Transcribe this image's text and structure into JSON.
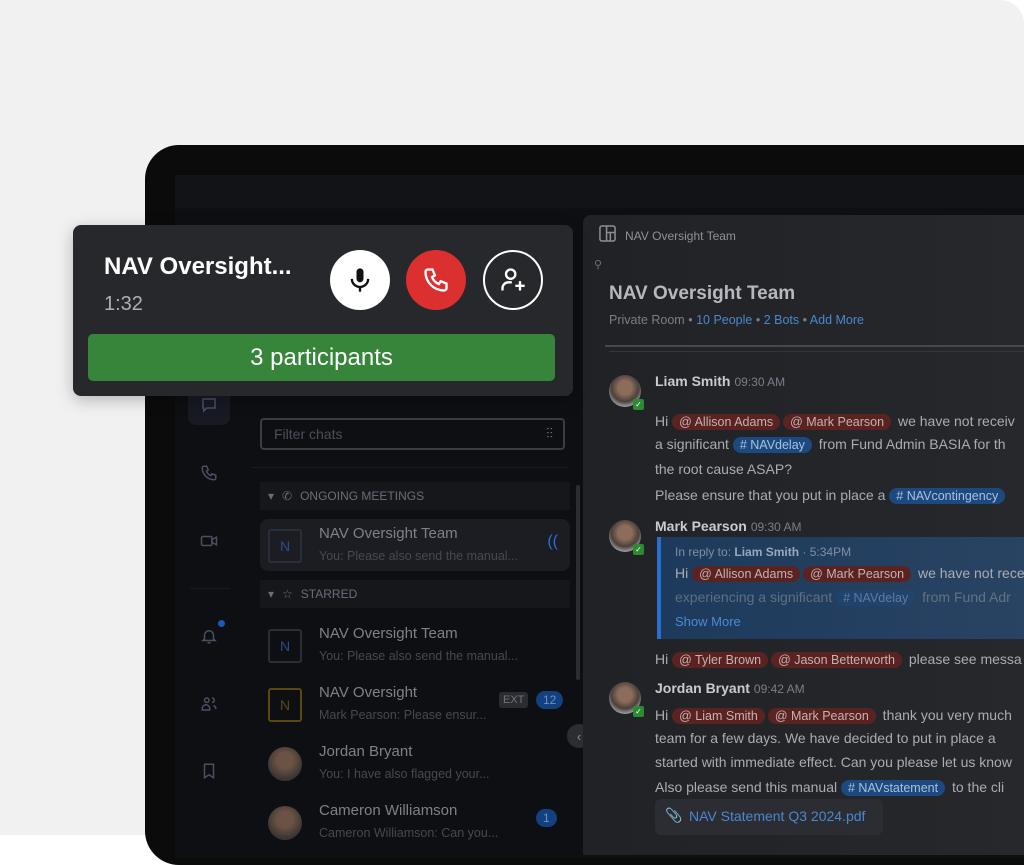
{
  "call": {
    "title": "NAV Oversight...",
    "duration": "1:32",
    "participants": "3 participants"
  },
  "chat_list": {
    "filter_placeholder": "Filter chats",
    "sections": {
      "ongoing": "ONGOING MEETINGS",
      "starred": "STARRED"
    },
    "ongoing": {
      "name": "NAV Oversight Team",
      "initial": "N",
      "preview": "You: Please also send the manual..."
    },
    "starred": [
      {
        "name": "NAV Oversight Team",
        "initial": "N",
        "preview": "You: Please also send the manual..."
      },
      {
        "name": "NAV Oversight",
        "initial": "N",
        "preview": "Mark Pearson: Please ensur...",
        "tag": "EXT",
        "badge": "12"
      },
      {
        "name": "Jordan Bryant",
        "preview": "You: I have also flagged your..."
      },
      {
        "name": "Cameron Williamson",
        "preview": "Cameron Williamson: Can you...",
        "badge": "1"
      }
    ]
  },
  "room": {
    "breadcrumb": "NAV Oversight Team",
    "title": "NAV Oversight Team",
    "type": "Private Room",
    "people": "10 People",
    "bots": "2 Bots",
    "add_more": "Add More"
  },
  "messages": [
    {
      "author": "Liam Smith",
      "time": "09:30 AM",
      "lines": [
        [
          [
            "t",
            "Hi "
          ],
          [
            "m",
            "@ Allison Adams"
          ],
          [
            "m",
            "@ Mark Pearson"
          ],
          [
            "t",
            " we have not receiv"
          ]
        ],
        [
          [
            "t",
            "a significant "
          ],
          [
            "h",
            "# NAVdelay"
          ],
          [
            "t",
            " from Fund Admin BASIA for th"
          ]
        ],
        [
          [
            "t",
            "the root cause ASAP?"
          ]
        ],
        [
          [
            "t",
            "Please ensure that you put in place a "
          ],
          [
            "h",
            "# NAVcontingency"
          ]
        ]
      ]
    },
    {
      "author": "Mark Pearson",
      "time": "09:30 AM",
      "reply": {
        "prefix": "In reply to: ",
        "author": "Liam Smith",
        "time": " · 5:34PM",
        "show_more": "Show More",
        "lines": [
          [
            [
              "t",
              "Hi "
            ],
            [
              "m",
              "@ Allison Adams"
            ],
            [
              "m",
              "@ Mark Pearson"
            ],
            [
              "t",
              " we have not rece"
            ]
          ],
          [
            [
              "t",
              "experiencing a significant "
            ],
            [
              "h",
              "# NAVdelay"
            ],
            [
              "t",
              " from Fund Adr"
            ]
          ]
        ]
      },
      "lines": [
        [
          [
            "t",
            "Hi "
          ],
          [
            "m",
            "@ Tyler Brown"
          ],
          [
            "m",
            "@ Jason Betterworth"
          ],
          [
            "t",
            " please see messa"
          ]
        ]
      ]
    },
    {
      "author": "Jordan Bryant",
      "time": "09:42 AM",
      "lines": [
        [
          [
            "t",
            "Hi "
          ],
          [
            "m",
            "@ Liam Smith"
          ],
          [
            "m",
            "@ Mark Pearson"
          ],
          [
            "t",
            " thank you very much"
          ]
        ],
        [
          [
            "t",
            "team for a few days. We have decided to put in place a"
          ]
        ],
        [
          [
            "t",
            "started with immediate effect. Can you please let us know"
          ]
        ],
        [
          [
            "t",
            "Also please send this manual "
          ],
          [
            "h",
            "# NAVstatement"
          ],
          [
            "t",
            " to the cli"
          ]
        ]
      ],
      "attachment": "NAV Statement Q3 2024.pdf"
    }
  ],
  "colors": {
    "accent": "#4a87cf",
    "hangup": "#dc3030",
    "participants_bar": "#37853a",
    "mention": "#5a2322",
    "hashtag": "#1c4a80"
  }
}
